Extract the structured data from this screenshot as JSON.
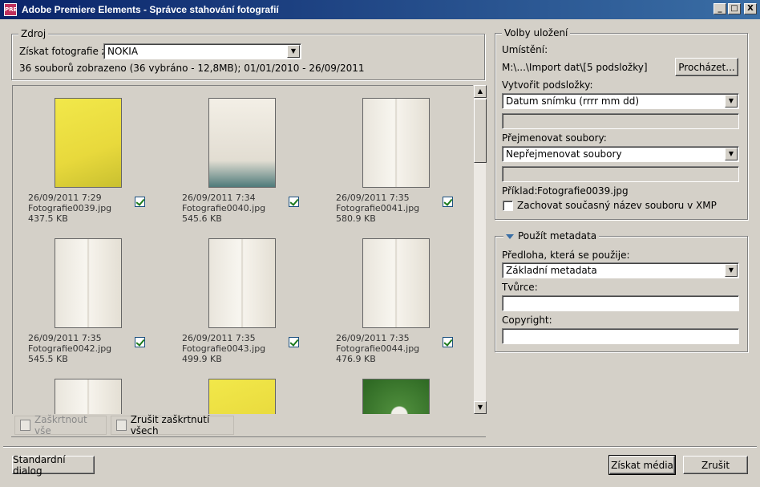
{
  "window": {
    "title": "Adobe Premiere Elements - Správce stahování fotografií",
    "icon_text": "PRE",
    "buttons": [
      "_",
      "□",
      "X"
    ]
  },
  "source": {
    "group_label": "Zdroj",
    "get_from_label": "Získat fotografie z:",
    "device_value": "NOKIA",
    "summary": "36 souborů zobrazeno (36 vybráno - 12,8MB); 01/01/2010 - 26/09/2011"
  },
  "photos": [
    {
      "date": "26/09/2011 7:29",
      "name": "Fotografie0039.jpg",
      "size": "437.5 KB",
      "checked": true,
      "tone": "yellow"
    },
    {
      "date": "26/09/2011 7:34",
      "name": "Fotografie0040.jpg",
      "size": "545.6 KB",
      "checked": true,
      "tone": "page"
    },
    {
      "date": "26/09/2011 7:35",
      "name": "Fotografie0041.jpg",
      "size": "580.9 KB",
      "checked": true,
      "tone": "book"
    },
    {
      "date": "26/09/2011 7:35",
      "name": "Fotografie0042.jpg",
      "size": "545.5 KB",
      "checked": true,
      "tone": "book"
    },
    {
      "date": "26/09/2011 7:35",
      "name": "Fotografie0043.jpg",
      "size": "499.9 KB",
      "checked": true,
      "tone": "book"
    },
    {
      "date": "26/09/2011 7:35",
      "name": "Fotografie0044.jpg",
      "size": "476.9 KB",
      "checked": true,
      "tone": "book"
    },
    {
      "tone": "book"
    },
    {
      "tone": "yellow"
    },
    {
      "tone": "green"
    }
  ],
  "toolbar": {
    "check_all": "Zaškrtnout vše",
    "uncheck_all": "Zrušit zaškrtnutí všech"
  },
  "save_options": {
    "group_label": "Volby uložení",
    "location_label": "Umístění:",
    "location_value": "M:\\...\\Import dat\\[5 podsložky]",
    "browse_button": "Procházet...",
    "subfolders_label": "Vytvořit podsložky:",
    "subfolders_value": "Datum snímku (rrrr mm dd)",
    "rename_label": "Přejmenovat soubory:",
    "rename_value": "Nepřejmenovat soubory",
    "example_label": "Příklad:",
    "example_value": "Fotografie0039.jpg",
    "keep_name_label": "Zachovat současný název souboru v XMP"
  },
  "metadata": {
    "group_label": "Použít metadata",
    "template_label": "Předloha, která se použije:",
    "template_value": "Základní metadata",
    "author_label": "Tvůrce:",
    "author_value": "",
    "copyright_label": "Copyright:",
    "copyright_value": ""
  },
  "footer": {
    "standard_dialog": "Standardní dialog",
    "get_media": "Získat média",
    "cancel": "Zrušit"
  }
}
